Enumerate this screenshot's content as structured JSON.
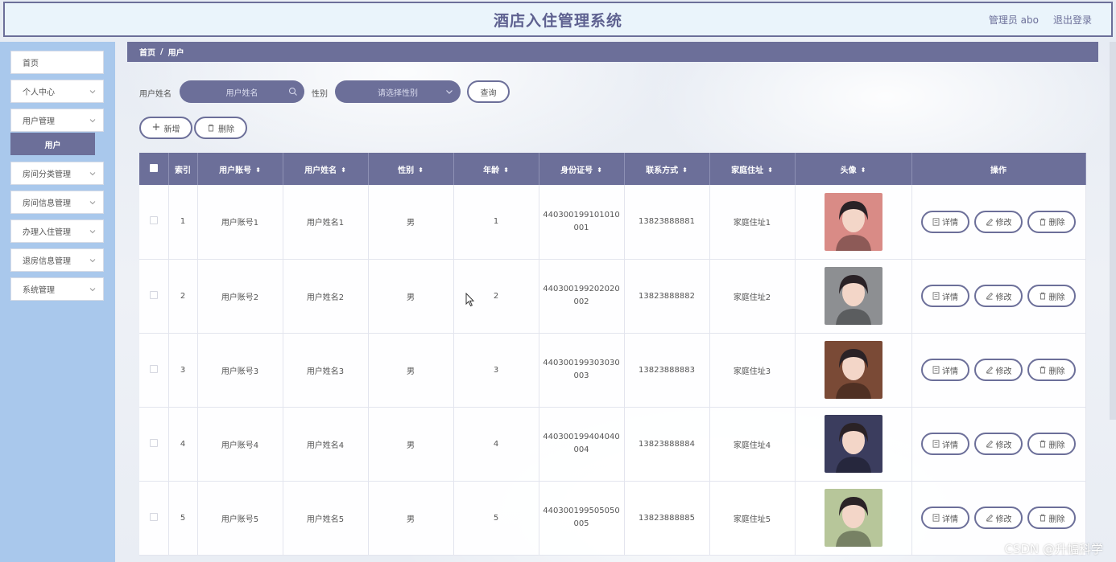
{
  "app": {
    "title": "酒店入住管理系统",
    "user_label": "管理员 abo",
    "logout_label": "退出登录"
  },
  "sidebar": {
    "items": [
      {
        "label": "首页",
        "has_children": false
      },
      {
        "label": "个人中心",
        "has_children": true
      },
      {
        "label": "用户管理",
        "has_children": true
      },
      {
        "label": "房间分类管理",
        "has_children": true
      },
      {
        "label": "房间信息管理",
        "has_children": true
      },
      {
        "label": "办理入住管理",
        "has_children": true
      },
      {
        "label": "退房信息管理",
        "has_children": true
      },
      {
        "label": "系统管理",
        "has_children": true
      }
    ],
    "active_sub": "用户"
  },
  "breadcrumb": {
    "home": "首页",
    "sep": "/",
    "current": "用户"
  },
  "search": {
    "name_label": "用户姓名",
    "name_placeholder": "用户姓名",
    "gender_label": "性别",
    "gender_placeholder": "请选择性别",
    "query_button": "查询"
  },
  "actions": {
    "add": "新增",
    "delete": "删除"
  },
  "table": {
    "headers": [
      "索引",
      "用户账号",
      "用户姓名",
      "性别",
      "年龄",
      "身份证号",
      "联系方式",
      "家庭住址",
      "头像",
      "操作"
    ],
    "rows": [
      {
        "index": "1",
        "account": "用户账号1",
        "name": "用户姓名1",
        "gender": "男",
        "age": "1",
        "id_line1": "440300199101010",
        "id_line2": "001",
        "phone": "13823888881",
        "address": "家庭住址1",
        "avatar_color": "#d98b86"
      },
      {
        "index": "2",
        "account": "用户账号2",
        "name": "用户姓名2",
        "gender": "男",
        "age": "2",
        "id_line1": "440300199202020",
        "id_line2": "002",
        "phone": "13823888882",
        "address": "家庭住址2",
        "avatar_color": "#8d8f92"
      },
      {
        "index": "3",
        "account": "用户账号3",
        "name": "用户姓名3",
        "gender": "男",
        "age": "3",
        "id_line1": "440300199303030",
        "id_line2": "003",
        "phone": "13823888883",
        "address": "家庭住址3",
        "avatar_color": "#7a4a36"
      },
      {
        "index": "4",
        "account": "用户账号4",
        "name": "用户姓名4",
        "gender": "男",
        "age": "4",
        "id_line1": "440300199404040",
        "id_line2": "004",
        "phone": "13823888884",
        "address": "家庭住址4",
        "avatar_color": "#3b3d5e"
      },
      {
        "index": "5",
        "account": "用户账号5",
        "name": "用户姓名5",
        "gender": "男",
        "age": "5",
        "id_line1": "440300199505050",
        "id_line2": "005",
        "phone": "13823888885",
        "address": "家庭住址5",
        "avatar_color": "#b7c69a"
      }
    ],
    "row_actions": {
      "detail": "详情",
      "edit": "修改",
      "delete": "删除"
    }
  },
  "watermark": "CSDN @升幅科学",
  "colors": {
    "primary": "#6c6f99",
    "sidebar_bg": "#a9c8ec",
    "header_bg": "#eaf4fb"
  }
}
